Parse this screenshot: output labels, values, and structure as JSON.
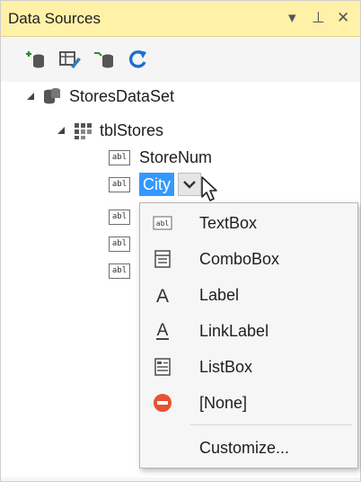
{
  "panel": {
    "title": "Data Sources",
    "controls": {
      "dropdown": "▾",
      "pin": "⊥",
      "close": "✕"
    }
  },
  "toolbar": {
    "icons": [
      "add-data-source-icon",
      "edit-dataset-designer-icon",
      "configure-dataset-icon",
      "refresh-icon"
    ]
  },
  "tree": {
    "dataset": "StoresDataSet",
    "table": "tblStores",
    "fields": [
      {
        "label": "StoreNum"
      },
      {
        "label": "City",
        "selected": true
      },
      {
        "label": ""
      },
      {
        "label": ""
      },
      {
        "label": ""
      }
    ],
    "field_icon_text": "abl"
  },
  "menu": {
    "items": [
      {
        "label": "TextBox",
        "icon": "textbox-icon"
      },
      {
        "label": "ComboBox",
        "icon": "combobox-icon"
      },
      {
        "label": "Label",
        "icon": "label-icon"
      },
      {
        "label": "LinkLabel",
        "icon": "linklabel-icon"
      },
      {
        "label": "ListBox",
        "icon": "listbox-icon"
      },
      {
        "label": "[None]",
        "icon": "none-icon"
      }
    ],
    "customize": "Customize..."
  },
  "colors": {
    "title_bar": "#fff1a8",
    "selection": "#3399ff",
    "none_icon": "#e8512f",
    "refresh_icon": "#1e6fd0"
  }
}
